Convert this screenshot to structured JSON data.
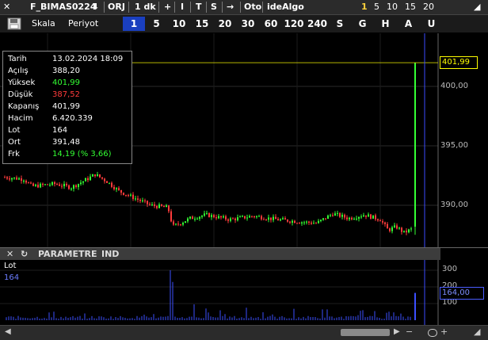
{
  "toolbar": {
    "symbol": "F_BIMAS0224",
    "download_icon": "download-arrow-icon",
    "orj": "ORJ",
    "interval": "1 dk",
    "plus": "+",
    "i": "I",
    "t": "T",
    "s": "S",
    "arrow": "→",
    "oto": "Oto",
    "idealgo": "ideAlgo",
    "counts": [
      "1",
      "5",
      "10",
      "15",
      "20"
    ]
  },
  "scale_bar": {
    "save_icon": "floppy-disk-icon",
    "skala": "Skala",
    "periyot": "Periyot",
    "periods": [
      "1",
      "5",
      "10",
      "15",
      "20",
      "30",
      "60",
      "120",
      "240",
      "S",
      "G",
      "H",
      "A",
      "U"
    ],
    "active_period": "1"
  },
  "info_box": {
    "rows": [
      {
        "label": "Tarih",
        "value": "13.02.2024 18:09",
        "color": "#ffffff"
      },
      {
        "label": "Açılış",
        "value": "388,20",
        "color": "#ffffff"
      },
      {
        "label": "Yüksek",
        "value": "401,99",
        "color": "#33ff33"
      },
      {
        "label": "Düşük",
        "value": "387,52",
        "color": "#ff3b3b"
      },
      {
        "label": "Kapanış",
        "value": "401,99",
        "color": "#ffffff"
      },
      {
        "label": "Hacim",
        "value": "6.420.339",
        "color": "#ffffff"
      },
      {
        "label": "Lot",
        "value": "164",
        "color": "#ffffff"
      },
      {
        "label": "Ort",
        "value": "391,48",
        "color": "#ffffff"
      },
      {
        "label": "Frk",
        "value": "14,19 (% 3,66)",
        "color": "#33ff33"
      }
    ]
  },
  "price_axis": {
    "labels": [
      "400,00",
      "395,00",
      "390,00"
    ],
    "last_price": "401,99"
  },
  "indicator": {
    "header": [
      "PARAMETRE",
      "IND"
    ],
    "close_icon": "close-icon",
    "refresh_icon": "refresh-icon",
    "series_label": "Lot",
    "series_value": "164",
    "axis_labels": [
      "300",
      "200",
      "100"
    ],
    "last_value": "164,00"
  },
  "colors": {
    "up": "#33ff33",
    "down": "#ff3b3b",
    "crosshair": "#3a4cff",
    "last_line": "#ffff00"
  }
}
